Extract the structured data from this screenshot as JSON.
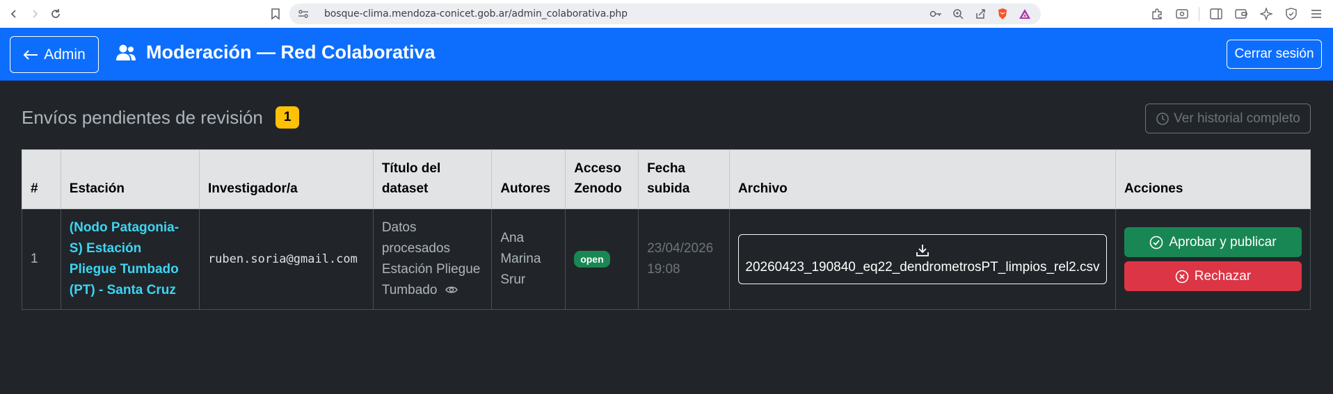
{
  "browser": {
    "url": "bosque-clima.mendoza-conicet.gob.ar/admin_colaborativa.php"
  },
  "header": {
    "back_label": "Admin",
    "title": "Moderación — Red Colaborativa",
    "logout_label": "Cerrar sesión",
    "brand_color": "#0d6efd"
  },
  "section": {
    "title": "Envíos pendientes de revisión",
    "pending_count": "1",
    "history_label": "Ver historial completo"
  },
  "table": {
    "columns": [
      "#",
      "Estación",
      "Investigador/a",
      "Título del dataset",
      "Autores",
      "Acceso Zenodo",
      "Fecha subida",
      "Archivo",
      "Acciones"
    ],
    "rows": [
      {
        "num": "1",
        "station": "(Nodo Patagonia-S) Estación Pliegue Tumbado (PT) - Santa Cruz",
        "researcher": "ruben.soria@gmail.com",
        "dataset_title": "Datos procesados Estación Pliegue Tumbado",
        "authors": "Ana Marina Srur",
        "access": "open",
        "upload_date": "23/04/2026",
        "upload_time": "19:08",
        "file": "20260423_190840_eq22_dendrometrosPT_limpios_rel2.csv",
        "approve_label": "Aprobar y publicar",
        "reject_label": "Rechazar"
      }
    ]
  },
  "icons": [
    "back-arrow-icon",
    "users-icon",
    "clock-history-icon",
    "download-icon",
    "check-circle-icon",
    "x-circle-icon",
    "eye-icon"
  ]
}
